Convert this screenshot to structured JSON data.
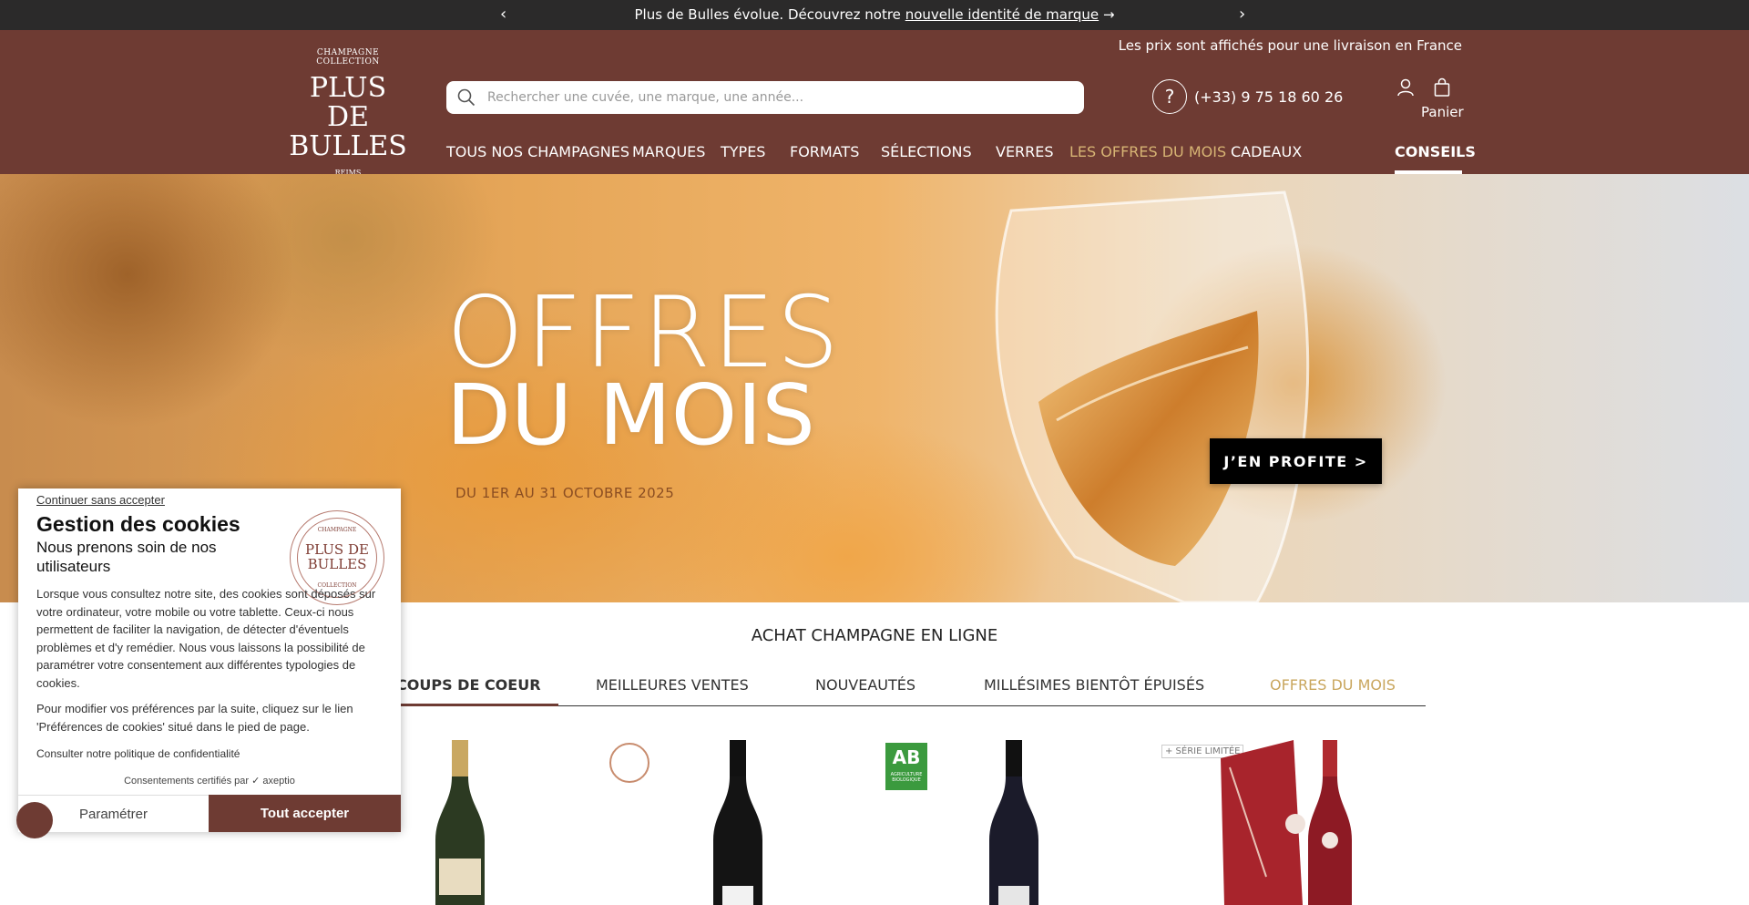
{
  "announcement": {
    "text_before": "Plus de Bulles évolue. Découvrez notre",
    "link_text": "nouvelle identité de marque",
    "arrow": "→",
    "prev_glyph": "‹",
    "next_glyph": "›"
  },
  "header": {
    "logo": {
      "top": "CHAMPAGNE COLLECTION",
      "line1": "PLUS DE",
      "line2": "BULLES",
      "bottom": "REIMS"
    },
    "price_note": "Les prix sont affichés pour une livraison en France",
    "search_placeholder": "Rechercher une cuvée, une marque, une année...",
    "phone_glyph": "?",
    "phone": "(+33) 9 75 18 60 26",
    "cart_label": "Panier",
    "icons": {
      "search": "search-icon",
      "help": "help-icon",
      "user": "user-icon",
      "cart": "cart-icon"
    }
  },
  "nav": [
    {
      "label": "TOUS NOS CHAMPAGNES"
    },
    {
      "label": "MARQUES"
    },
    {
      "label": "TYPES"
    },
    {
      "label": "FORMATS"
    },
    {
      "label": "SÉLECTIONS"
    },
    {
      "label": "VERRES"
    },
    {
      "label": "LES OFFRES DU MOIS"
    },
    {
      "label": "CADEAUX"
    },
    {
      "label": "CONSEILS"
    }
  ],
  "hero": {
    "line1": "OFFRES",
    "line2": "DU MOIS",
    "dates": "DU 1ER AU 31 OCTOBRE 2025",
    "cta": "J’EN PROFITE >"
  },
  "section": {
    "title": "ACHAT CHAMPAGNE EN LIGNE",
    "tabs": [
      {
        "label": "COUPS DE COEUR"
      },
      {
        "label": "MEILLEURES VENTES"
      },
      {
        "label": "NOUVEAUTÉS"
      },
      {
        "label": "MILLÉSIMES BIENTÔT ÉPUISÉS"
      },
      {
        "label": "OFFRES DU MOIS"
      }
    ]
  },
  "products": {
    "badge_ab": "AB",
    "badge_ab_sub": "AGRICULTURE BIOLOGIQUE",
    "serie_label": "+ SÉRIE LIMITÉE"
  },
  "cookie": {
    "skip": "Continuer sans accepter",
    "title": "Gestion des cookies",
    "subtitle": "Nous prenons soin de nos utilisateurs",
    "seal": {
      "top": "CHAMPAGNE",
      "line1": "PLUS DE",
      "line2": "BULLES",
      "bottom": "COLLECTION"
    },
    "body": "Lorsque vous consultez notre site, des cookies sont déposés sur votre ordinateur, votre mobile ou votre tablette. Ceux-ci nous permettent de faciliter la navigation, de détecter d'éventuels problèmes et d'y remédier. Nous vous laissons la possibilité de paramétrer votre consentement aux différentes typologies de cookies.",
    "body2": "Pour modifier vos préférences par la suite, cliquez sur le lien 'Préférences de cookies' situé dans le pied de page.",
    "policy": "Consulter notre politique de confidentialité",
    "certified": "Consentements certifiés par ✓ axeptio",
    "param_button": "Paramétrer",
    "accept_button": "Tout accepter"
  },
  "colors": {
    "brand": "#6e3b33",
    "topbar": "#2b2a2a",
    "gold": "#d7b474"
  }
}
